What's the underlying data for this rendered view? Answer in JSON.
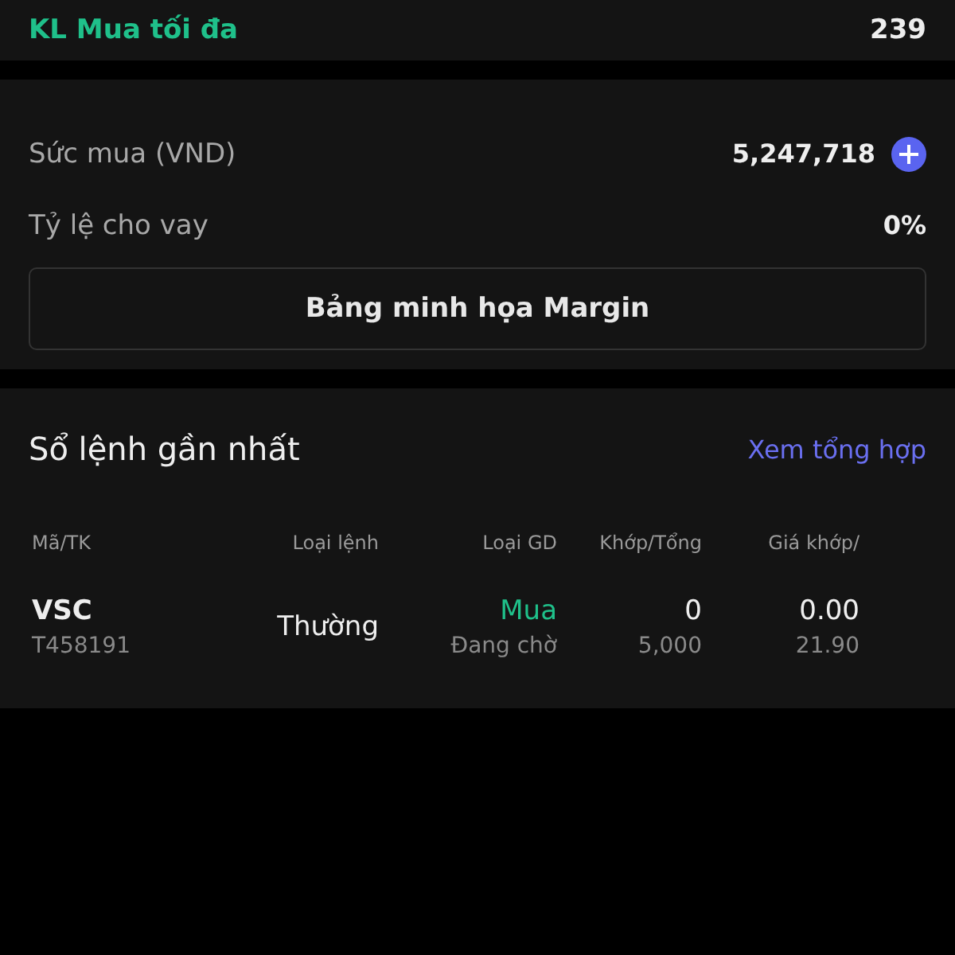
{
  "max_buy": {
    "label": "KL Mua tối đa",
    "value": "239"
  },
  "account": {
    "rows": [
      {
        "label": "Sức mua (VND)",
        "value": "5,247,718",
        "kind": "add"
      },
      {
        "label": "Tỷ lệ cho vay",
        "value": "0%",
        "kind": "plain"
      }
    ],
    "button": "Bảng minh họa Margin"
  },
  "orders": {
    "title": "Sổ lệnh gần nhất",
    "link": "Xem tổng hợp",
    "columns": [
      "Mã/TK",
      "Loại lệnh",
      "Loại GD",
      "Khớp/Tổng",
      "Giá khớp/"
    ],
    "rows": [
      {
        "symbol": "VSC",
        "account": "T458191",
        "order_type": "Thường",
        "side": "Mua",
        "status": "Đang chờ",
        "matched": "0",
        "total": "5,000",
        "match_price": "0.00",
        "price": "21.90"
      }
    ]
  }
}
